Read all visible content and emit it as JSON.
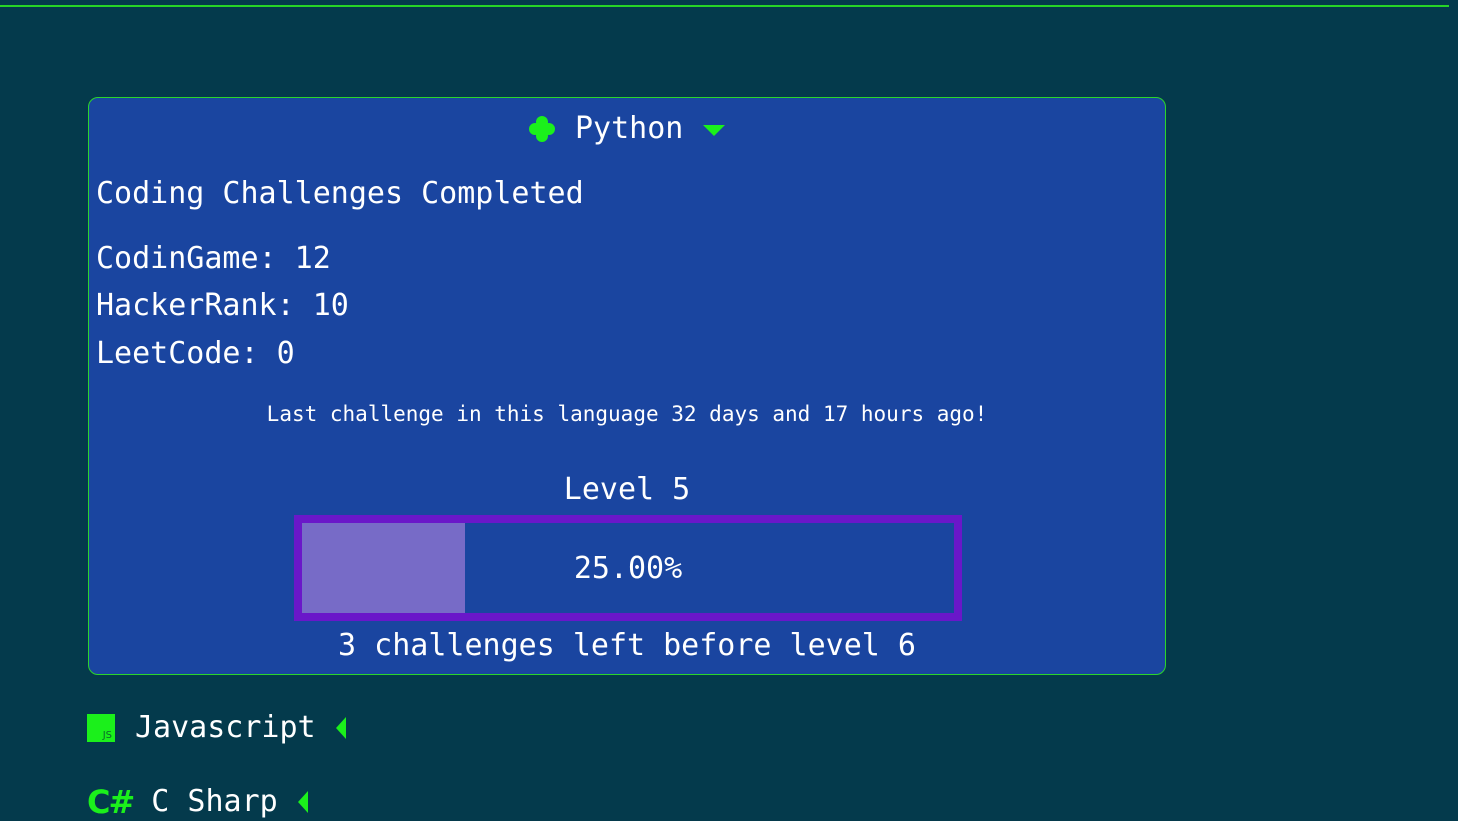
{
  "colors": {
    "page_background": "#043a4c",
    "card_background": "#1a45a0",
    "accent_green": "#1bf01b",
    "progress_border": "#6a17c9",
    "progress_fill": "#776bc7",
    "text": "#ffffff"
  },
  "expanded_language": {
    "icon": "python-icon",
    "name": "Python",
    "toggle_icon": "caret-down-icon",
    "heading": "Coding Challenges Completed",
    "stats": [
      {
        "label": "CodinGame: 12"
      },
      {
        "label": "HackerRank: 10"
      },
      {
        "label": "LeetCode: 0"
      }
    ],
    "last_challenge": "Last challenge in this language 32 days and 17 hours ago!",
    "level_label": "Level 5",
    "progress_fraction": 0.25,
    "progress_text": "25.00%",
    "challenges_left": "3 challenges left before level 6"
  },
  "collapsed_languages": [
    {
      "icon": "javascript-icon",
      "icon_text": "JS",
      "name": "Javascript",
      "toggle_icon": "caret-left-icon"
    },
    {
      "icon": "csharp-icon",
      "icon_text": "C#",
      "name": "C Sharp",
      "toggle_icon": "caret-left-icon"
    }
  ]
}
